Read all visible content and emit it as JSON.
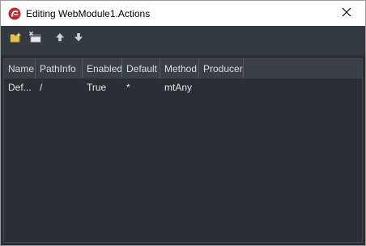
{
  "window": {
    "title": "Editing WebModule1.Actions",
    "app_icon": "delphi-helmet-icon",
    "close_icon": "close-icon"
  },
  "toolbar": {
    "buttons": [
      {
        "name": "add-new-action-button",
        "icon": "new-item-icon"
      },
      {
        "name": "delete-action-button",
        "icon": "delete-item-icon"
      },
      {
        "name": "move-up-button",
        "icon": "arrow-up-icon"
      },
      {
        "name": "move-down-button",
        "icon": "arrow-down-icon"
      }
    ]
  },
  "list": {
    "columns": [
      "Name",
      "PathInfo",
      "Enabled",
      "Default",
      "Method",
      "Producer"
    ],
    "rows": [
      [
        "Def...",
        "/",
        "True",
        "*",
        "mtAny",
        ""
      ]
    ]
  },
  "colors": {
    "background": "#2b2e33",
    "toolbar": "#353a40",
    "header": "#3b4047",
    "accent": "#c0262d"
  }
}
